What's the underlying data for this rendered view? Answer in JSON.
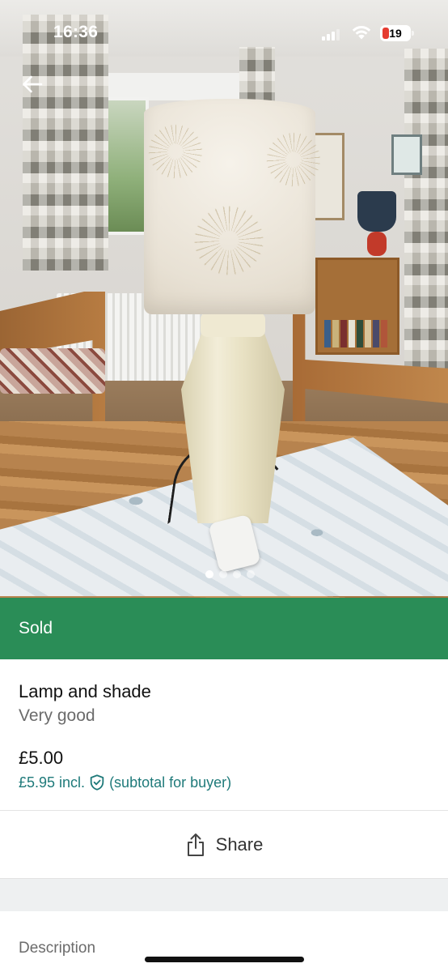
{
  "status_bar": {
    "time": "16:36",
    "battery_level": "19",
    "battery_color": "#e53b30"
  },
  "navigation": {
    "back_icon": "arrow-left-icon"
  },
  "gallery": {
    "photo_count": 4,
    "active_index": 0
  },
  "banner": {
    "label": "Sold",
    "color": "#2a8d57"
  },
  "item": {
    "title": "Lamp and shade",
    "condition": "Very good",
    "price": "£5.00",
    "buyer_price_prefix": "£5.95 incl.",
    "buyer_price_suffix": "(subtotal for buyer)",
    "protection_icon": "shield-check-icon",
    "accent_color": "#1f7a7a"
  },
  "actions": {
    "share_label": "Share",
    "share_icon": "share-icon"
  },
  "description": {
    "heading": "Description"
  }
}
